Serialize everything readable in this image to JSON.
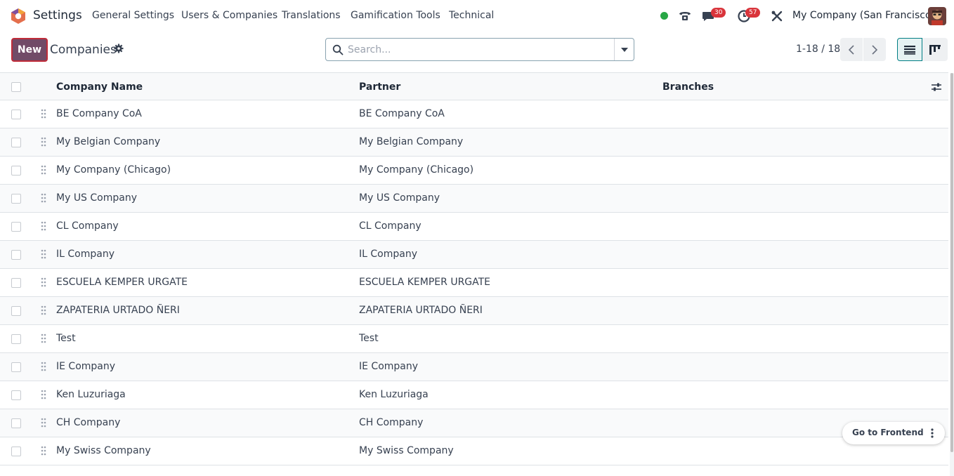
{
  "navbar": {
    "app_name": "Settings",
    "menus": [
      "General Settings",
      "Users & Companies",
      "Translations",
      "Gamification Tools",
      "Technical"
    ],
    "messages_badge": "30",
    "activities_badge": "57",
    "company_switch": "My Company (San Francisco)",
    "colors": {
      "brand": "#714b67",
      "badge": "#d9343b",
      "presence": "#28a745"
    }
  },
  "control_panel": {
    "new_label": "New",
    "title": "Companies",
    "search_placeholder": "Search...",
    "pager_value": "1-18 / 18"
  },
  "table": {
    "columns": [
      "Company Name",
      "Partner",
      "Branches"
    ],
    "rows": [
      {
        "name": "BE Company CoA",
        "partner": "BE Company CoA"
      },
      {
        "name": "My Belgian Company",
        "partner": "My Belgian Company"
      },
      {
        "name": "My Company (Chicago)",
        "partner": "My Company (Chicago)"
      },
      {
        "name": "My US Company",
        "partner": "My US Company"
      },
      {
        "name": "CL Company",
        "partner": "CL Company"
      },
      {
        "name": "IL Company",
        "partner": "IL Company"
      },
      {
        "name": "ESCUELA KEMPER URGATE",
        "partner": "ESCUELA KEMPER URGATE"
      },
      {
        "name": "ZAPATERIA URTADO ÑERI",
        "partner": "ZAPATERIA URTADO ÑERI"
      },
      {
        "name": "Test",
        "partner": "Test"
      },
      {
        "name": "IE Company",
        "partner": "IE Company"
      },
      {
        "name": "Ken Luzuriaga",
        "partner": "Ken Luzuriaga"
      },
      {
        "name": "CH Company",
        "partner": "CH Company"
      },
      {
        "name": "My Swiss Company",
        "partner": "My Swiss Company"
      }
    ]
  },
  "floating": {
    "frontend_label": "Go to Frontend"
  }
}
